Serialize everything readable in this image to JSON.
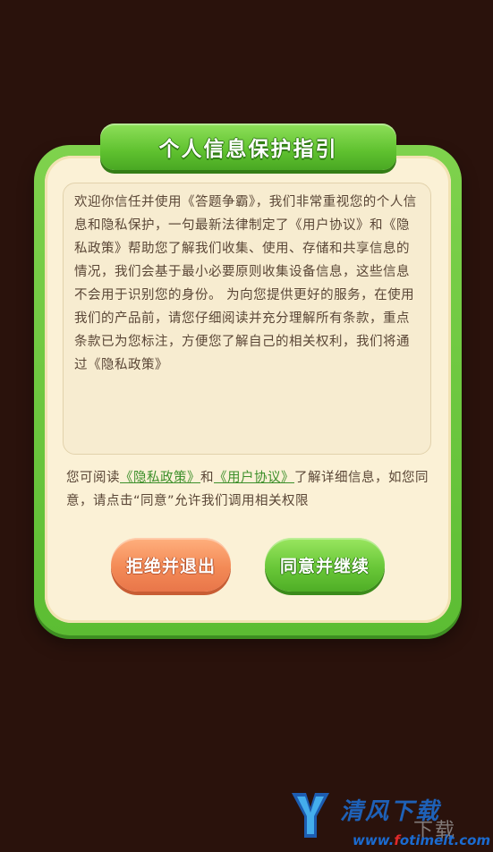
{
  "dialog": {
    "title": "个人信息保护指引",
    "content": "欢迎你信任并使用《答题争霸》，我们非常重视您的个人信息和隐私保护，一句最新法律制定了《用户协议》和《隐私政策》帮助您了解我们收集、使用、存储和共享信息的情况，我们会基于最小必要原则收集设备信息，这些信息不会用于识别您的身份。 为向您提供更好的服务，在使用我们的产品前，请您仔细阅读并充分理解所有条款，重点条款已为您标注，方便您了解自己的相关权利，我们将通过《隐私政策》",
    "footer": {
      "prefix": "您可阅读",
      "privacy_link": "《隐私政策》",
      "and": "和",
      "user_link": "《用户协议》",
      "suffix": "了解详细信息，如您同意，请点击“同意”允许我们调用相关权限"
    },
    "reject_button": "拒绝并退出",
    "agree_button": "同意并继续"
  },
  "watermark": {
    "brand_cn": "清风下载",
    "brand_cn_secondary": "下载",
    "url_prefix": "www.",
    "url_accent": "f",
    "url_rest": "otimeit.com"
  },
  "colors": {
    "background": "#2a120c",
    "frame_green": "#5cbd33",
    "panel_cream": "#fbf1d6",
    "reject_orange": "#f38a56",
    "agree_green": "#69c738",
    "link_green": "#3c8f2a",
    "text_brown": "#5a4636"
  }
}
